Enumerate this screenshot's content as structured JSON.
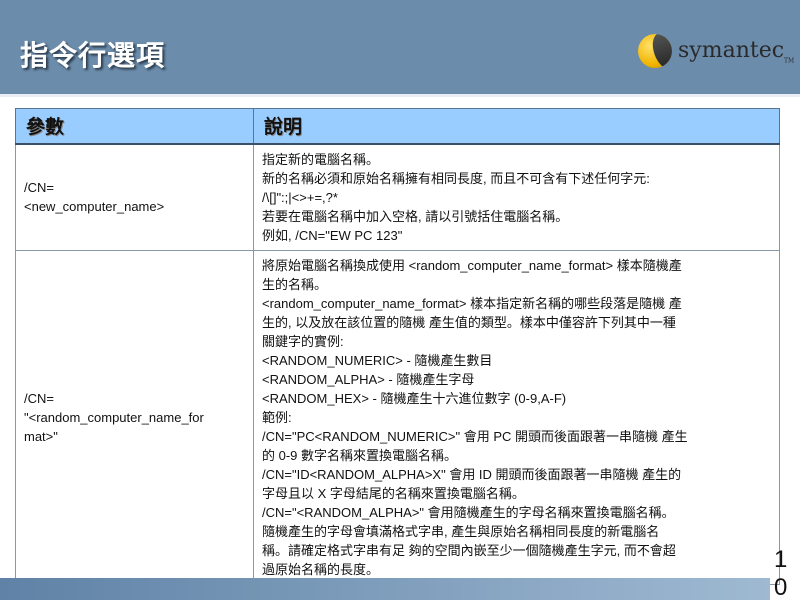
{
  "slide": {
    "title": "指令行選項",
    "page_number": "10",
    "logo_text": "symantec",
    "logo_tm": "TM"
  },
  "table": {
    "headers": [
      "參數",
      "說明"
    ],
    "rows": [
      {
        "param": [
          "/CN=",
          "<new_computer_name>"
        ],
        "desc": [
          "指定新的電腦名稱。",
          "新的名稱必須和原始名稱擁有相同長度, 而且不可含有下述任何字元:",
          "/\\[]\":;|<>+=,?*",
          "若要在電腦名稱中加入空格, 請以引號括住電腦名稱。",
          "例如, /CN=\"EW PC 123\""
        ]
      },
      {
        "param": [
          "/CN=",
          "\"<random_computer_name_for",
          "mat>\""
        ],
        "desc": [
          "將原始電腦名稱換成使用 <random_computer_name_format> 樣本隨機產",
          "生的名稱。",
          "<random_computer_name_format> 樣本指定新名稱的哪些段落是隨機 產",
          "生的, 以及放在該位置的隨機 產生值的類型。樣本中僅容許下列其中一種",
          "關鍵字的實例:",
          "<RANDOM_NUMERIC> - 隨機產生數目",
          "<RANDOM_ALPHA> - 隨機產生字母",
          "<RANDOM_HEX> - 隨機產生十六進位數字 (0-9,A-F)",
          "範例:",
          "/CN=\"PC<RANDOM_NUMERIC>\" 會用 PC 開頭而後面跟著一串隨機 產生",
          "的 0-9 數字名稱來置換電腦名稱。",
          "/CN=\"ID<RANDOM_ALPHA>X\" 會用 ID 開頭而後面跟著一串隨機 產生的",
          "字母且以 X 字母結尾的名稱來置換電腦名稱。",
          "/CN=\"<RANDOM_ALPHA>\" 會用隨機產生的字母名稱來置換電腦名稱。",
          "隨機產生的字母會填滿格式字串, 產生與原始名稱相同長度的新電腦名",
          "稱。請確定格式字串有足 夠的空間內嵌至少一個隨機產生字元, 而不會超",
          "過原始名稱的長度。"
        ]
      }
    ]
  }
}
